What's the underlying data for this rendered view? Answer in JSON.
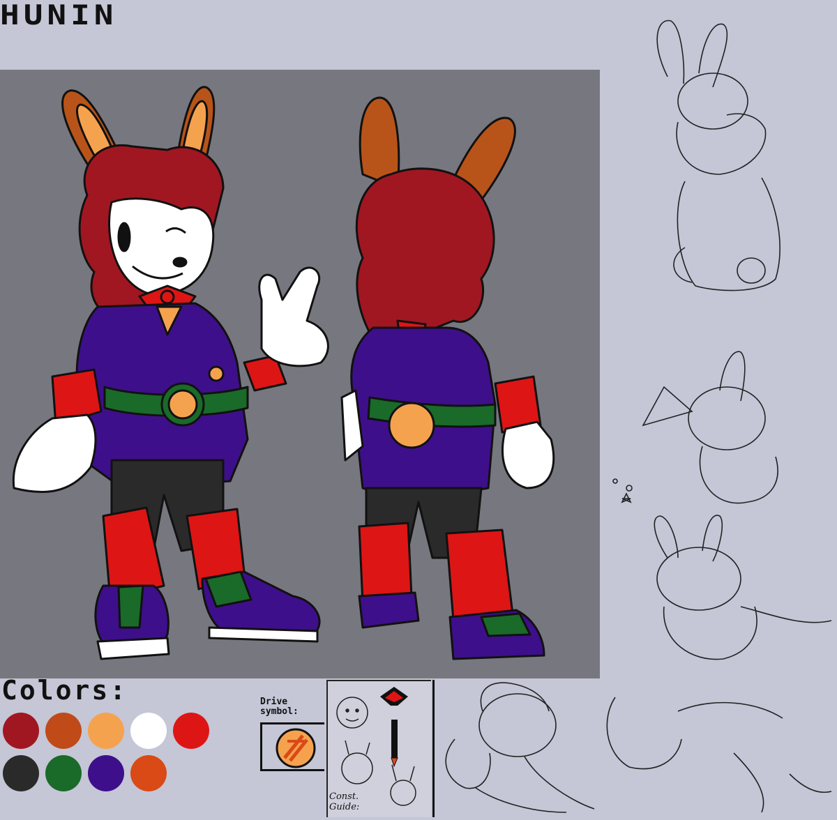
{
  "title": "HUNIN",
  "colors_label": "Colors:",
  "drive_symbol_label": "Drive\nsymbol:",
  "guide_label": "Const.\nGuide:",
  "palette": [
    "#a01722",
    "#c04a18",
    "#f5a24f",
    "#ffffff",
    "#de1515",
    "#2a2a2a",
    "#1a6a2a",
    "#3e0f8a",
    "#d94a16"
  ],
  "character_colors": {
    "hair": "#a01722",
    "ear_outer": "#b85419",
    "ear_inner": "#f5a24f",
    "jacket": "#3e0f8a",
    "cuffs": "#de1515",
    "belt": "#1a6a2a",
    "pants": "#2a2a2a",
    "buckle": "#f5a24f",
    "background_panel": "#77777f",
    "page_background": "#c5c6d6"
  }
}
